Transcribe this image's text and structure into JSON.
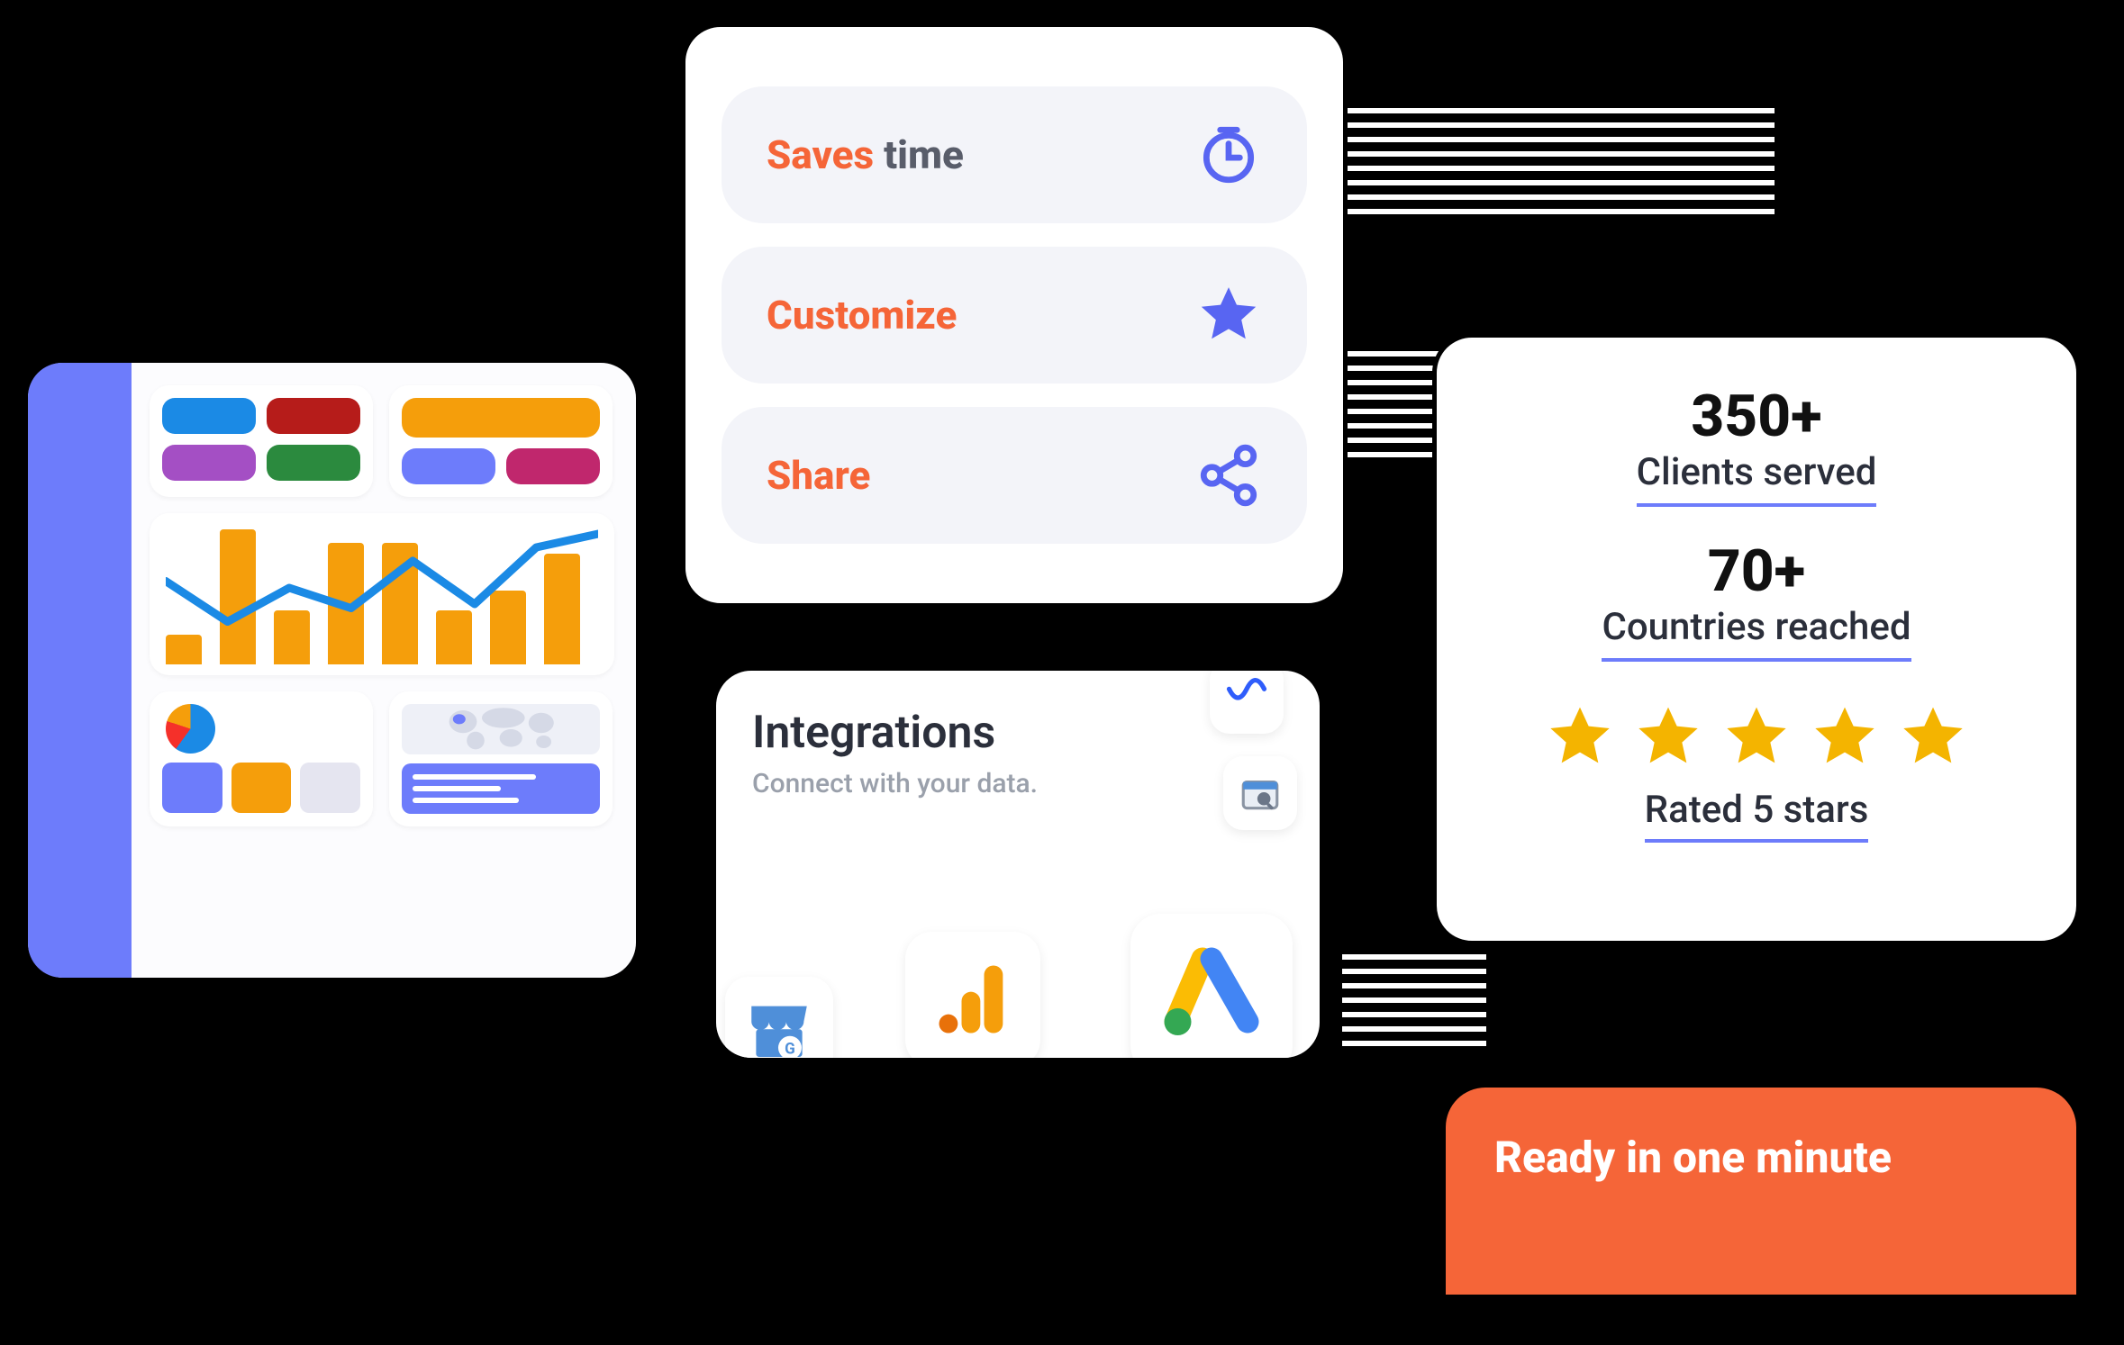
{
  "features": {
    "items": [
      {
        "accent": "Saves",
        "rest": " time",
        "icon": "clock-icon"
      },
      {
        "accent": "Customize",
        "rest": "",
        "icon": "star-icon"
      },
      {
        "accent": "Share",
        "rest": "",
        "icon": "share-icon"
      }
    ]
  },
  "integrations": {
    "title": "Integrations",
    "subtitle": "Connect with your data.",
    "providers": [
      "wordpress",
      "search-console",
      "google-my-business",
      "google-analytics",
      "google-ads"
    ]
  },
  "stats": {
    "clients_value": "350+",
    "clients_label": "Clients served",
    "countries_value": "70+",
    "countries_label": "Countries reached",
    "rating_value": 5,
    "rating_label": "Rated 5 stars"
  },
  "banner": {
    "text": "Ready in one minute"
  },
  "dashboard": {
    "chart_bars": [
      22,
      100,
      40,
      90,
      90,
      40,
      55,
      82
    ],
    "chart_line": [
      55,
      25,
      50,
      35,
      70,
      38,
      80,
      90
    ]
  },
  "colors": {
    "accent_orange": "#f56538",
    "accent_blue": "#6d7cfb",
    "star_gold": "#f4b400"
  }
}
